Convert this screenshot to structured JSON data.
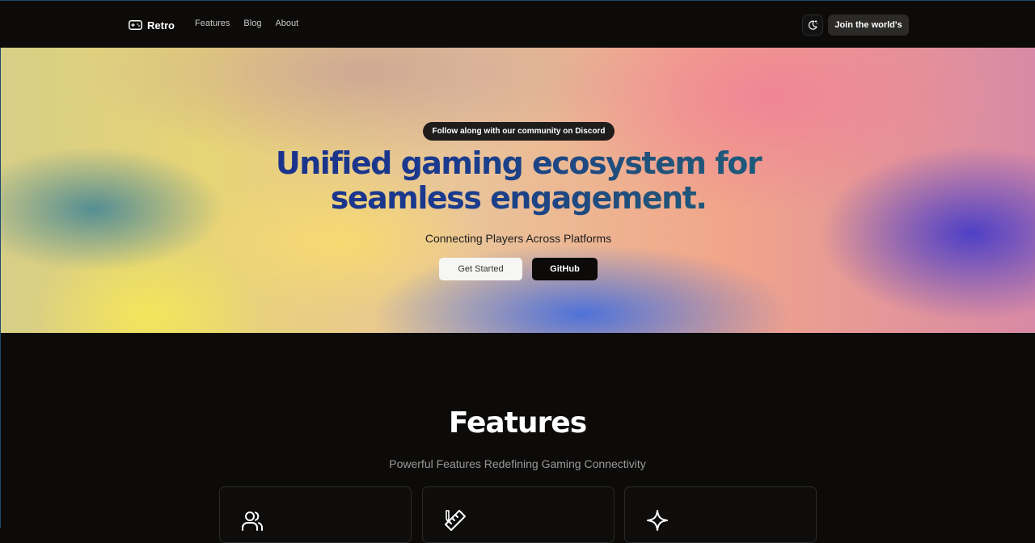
{
  "header": {
    "brand": {
      "name": "Retro",
      "icon": "gamepad-icon"
    },
    "nav": [
      {
        "label": "Features"
      },
      {
        "label": "Blog"
      },
      {
        "label": "About"
      }
    ],
    "theme_toggle": {
      "icon": "moon-stars-icon"
    },
    "cta_label": "Join the world's"
  },
  "hero": {
    "pill_label": "Follow along with our community on Discord",
    "title_line1": "Unified gaming ecosystem for",
    "title_line2": "seamless engagement.",
    "subtitle": "Connecting Players Across Platforms",
    "primary_button": "Get Started",
    "secondary_button": "GitHub"
  },
  "features": {
    "title": "Features",
    "subtitle": "Powerful Features Redefining Gaming Connectivity",
    "cards": [
      {
        "icon": "users-icon"
      },
      {
        "icon": "pencil-ruler-icon"
      },
      {
        "icon": "sparkle-icon"
      }
    ]
  },
  "colors": {
    "background": "#0c0b0a",
    "title_gradient_start": "#1c2f8a",
    "title_gradient_end": "#19607a",
    "primary_button_bg": "#f6f6f4",
    "card_border": "#2a2a2a"
  }
}
